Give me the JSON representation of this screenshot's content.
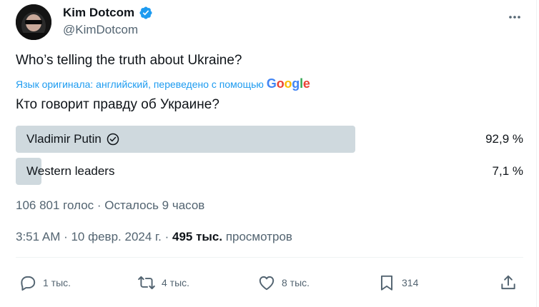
{
  "author": {
    "display_name": "Kim Dotcom",
    "handle": "@KimDotcom"
  },
  "tweet": {
    "text": "Who’s telling the truth about Ukraine?",
    "translation_note": "Язык оригинала: английский, переведено с помощью",
    "translated_text": "Кто говорит правду об Украине?"
  },
  "google_logo": {
    "letters": [
      {
        "ch": "G",
        "color": "#4285F4"
      },
      {
        "ch": "o",
        "color": "#EA4335"
      },
      {
        "ch": "o",
        "color": "#FBBC05"
      },
      {
        "ch": "g",
        "color": "#4285F4"
      },
      {
        "ch": "l",
        "color": "#34A853"
      },
      {
        "ch": "e",
        "color": "#EA4335"
      }
    ]
  },
  "poll": {
    "options": [
      {
        "label": "Vladimir Putin",
        "percent_text": "92,9 %",
        "percent": 92.9,
        "winner": true
      },
      {
        "label": "Western leaders",
        "percent_text": "7,1 %",
        "percent": 7.1,
        "winner": false
      }
    ],
    "meta": "106 801 голос · Осталось 9 часов"
  },
  "meta": {
    "time_date": "3:51 AM · 10 февр. 2024 г. · ",
    "views_count": "495 тыс.",
    "views_label": " просмотров"
  },
  "actions": {
    "reply_count": "1 тыс.",
    "retweet_count": "4 тыс.",
    "like_count": "8 тыс.",
    "bookmark_count": "314"
  },
  "colors": {
    "accent": "#1d9bf0",
    "poll_bar": "#cfd9de",
    "muted": "#536471",
    "text": "#0f1419"
  },
  "icons": [
    "verified-badge-icon",
    "more-icon",
    "check-circle-icon",
    "reply-icon",
    "retweet-icon",
    "like-icon",
    "bookmark-icon",
    "share-icon"
  ]
}
